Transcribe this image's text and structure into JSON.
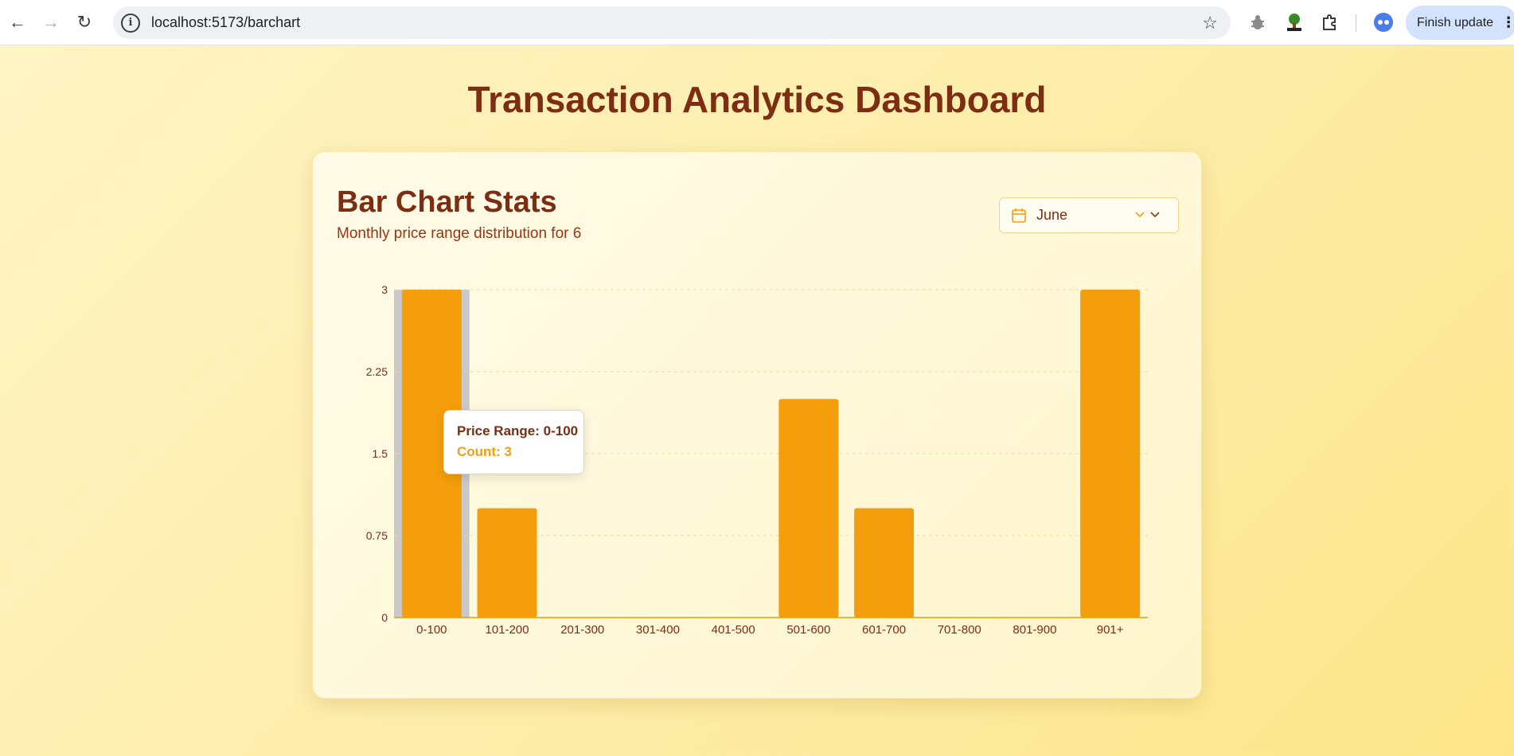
{
  "browser": {
    "url": "localhost:5173/barchart",
    "finish_update_label": "Finish update"
  },
  "page": {
    "title": "Transaction Analytics Dashboard"
  },
  "card": {
    "title": "Bar Chart Stats",
    "subtitle": "Monthly price range distribution for 6",
    "month_selected": "June"
  },
  "tooltip": {
    "label": "Price Range: 0-100",
    "count": "Count: 3"
  },
  "colors": {
    "bar": "#f59e0b",
    "title": "#7c2d12",
    "hover_band": "#c9c9c9"
  },
  "chart_data": {
    "type": "bar",
    "categories": [
      "0-100",
      "101-200",
      "201-300",
      "301-400",
      "401-500",
      "501-600",
      "601-700",
      "701-800",
      "801-900",
      "901+"
    ],
    "values": [
      3,
      1,
      0,
      0,
      0,
      2,
      1,
      0,
      0,
      3
    ],
    "ylim": [
      0,
      3
    ],
    "yticks": [
      "0",
      "0.75",
      "1.5",
      "2.25",
      "3"
    ],
    "grid": true,
    "active_category": "0-100"
  }
}
